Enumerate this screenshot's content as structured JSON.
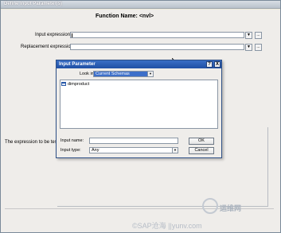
{
  "window": {
    "title": "Define Input Parameter(s)"
  },
  "main": {
    "function_name_label": "Function Name: <nvl>",
    "input_expression_label": "Input expression:",
    "replacement_expression_label": "Replacement expression:",
    "dropdown_glyph": "▼",
    "browse_label": "...",
    "expression_test_label": "The expression to be teste"
  },
  "dialog": {
    "title": "Input Parameter",
    "help_label": "?",
    "close_label": "X",
    "look_in_label": "Look in:",
    "look_in_value": "Current Schemas",
    "list_items": [
      "dimproduct"
    ],
    "input_name_label": "Input name:",
    "input_type_label": "Input type:",
    "input_type_value": "Any",
    "ok_label": "OK",
    "cancel_label": "Cancel"
  },
  "watermark": {
    "site_cn": "运维网",
    "text": "©SAP沧海 ||yunv.com"
  }
}
